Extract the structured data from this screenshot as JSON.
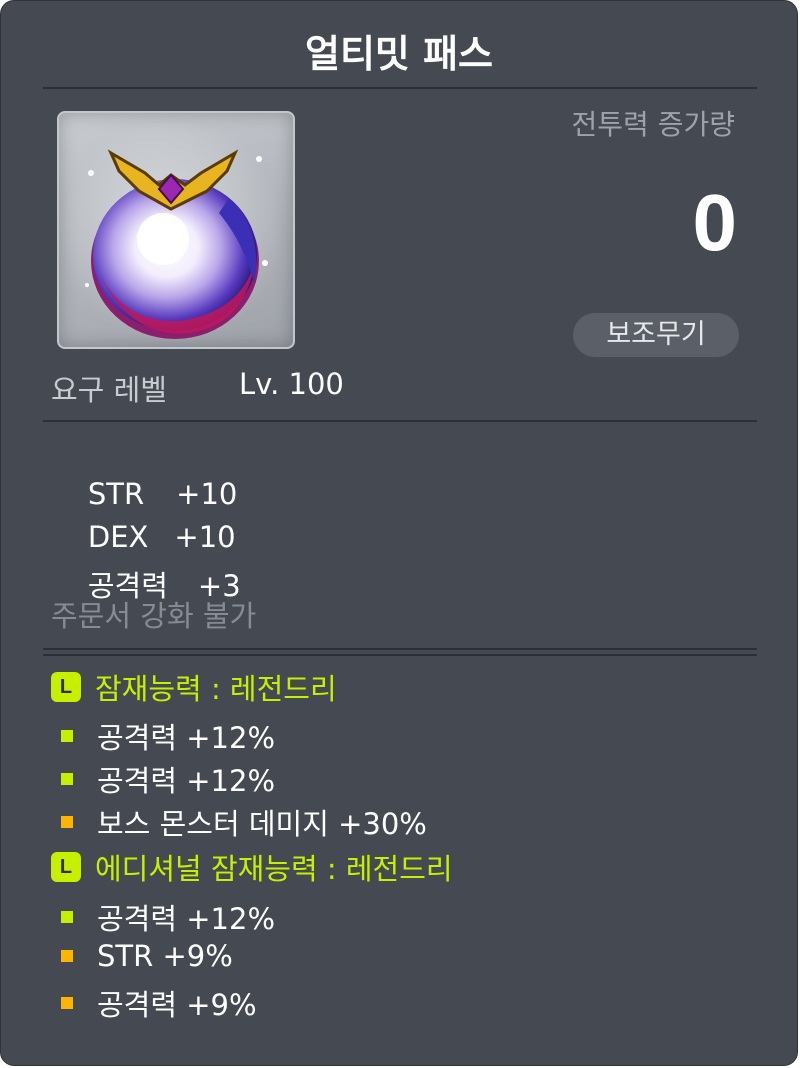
{
  "item": {
    "name": "얼티밋 패스",
    "icon": "ultimate-pass-orb-pendant"
  },
  "combat_power": {
    "label": "전투력 증가량",
    "value": "0"
  },
  "category": "보조무기",
  "requirement": {
    "label": "요구 레벨",
    "value": "Lv. 100"
  },
  "stats": [
    {
      "name": "STR",
      "value": "+10"
    },
    {
      "name": "DEX",
      "value": "+10"
    },
    {
      "name": "공격력",
      "value": "+3"
    }
  ],
  "scroll_note": "주문서 강화 불가",
  "potential": {
    "badge": "L",
    "header": "잠재능력 : 레전드리",
    "lines": [
      {
        "text": "공격력 +12%",
        "tier": "green"
      },
      {
        "text": "공격력 +12%",
        "tier": "green"
      },
      {
        "text": "보스 몬스터 데미지 +30%",
        "tier": "gold"
      }
    ]
  },
  "additional_potential": {
    "badge": "L",
    "header": "에디셔널 잠재능력 : 레전드리",
    "lines": [
      {
        "text": "공격력 +12%",
        "tier": "green"
      },
      {
        "text": "STR +9%",
        "tier": "gold"
      },
      {
        "text": "공격력 +9%",
        "tier": "gold"
      }
    ]
  },
  "colors": {
    "panel_bg": "#454a52",
    "legendary_green": "#c7f000",
    "gold_bullet": "#ffb400",
    "muted_text": "#878c93"
  }
}
